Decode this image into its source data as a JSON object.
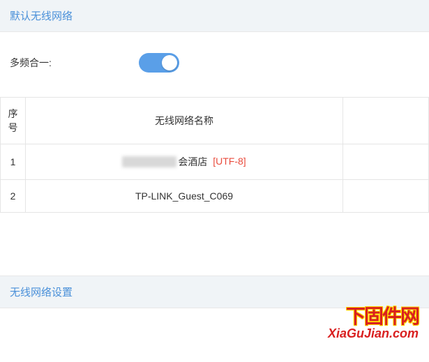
{
  "section1": {
    "title": "默认无线网络"
  },
  "form": {
    "multiband_label": "多频合一:",
    "multiband_on": true
  },
  "table": {
    "headers": {
      "index": "序号",
      "name": "无线网络名称",
      "action": ""
    },
    "rows": [
      {
        "index": "1",
        "name_prefix_redacted": true,
        "name_suffix": "会酒店",
        "encoding": "[UTF-8]"
      },
      {
        "index": "2",
        "name": "TP-LINK_Guest_C069"
      }
    ]
  },
  "section2": {
    "title": "无线网络设置"
  },
  "watermark": {
    "chinese": "下固件网",
    "domain": "XiaGuJian.com"
  }
}
